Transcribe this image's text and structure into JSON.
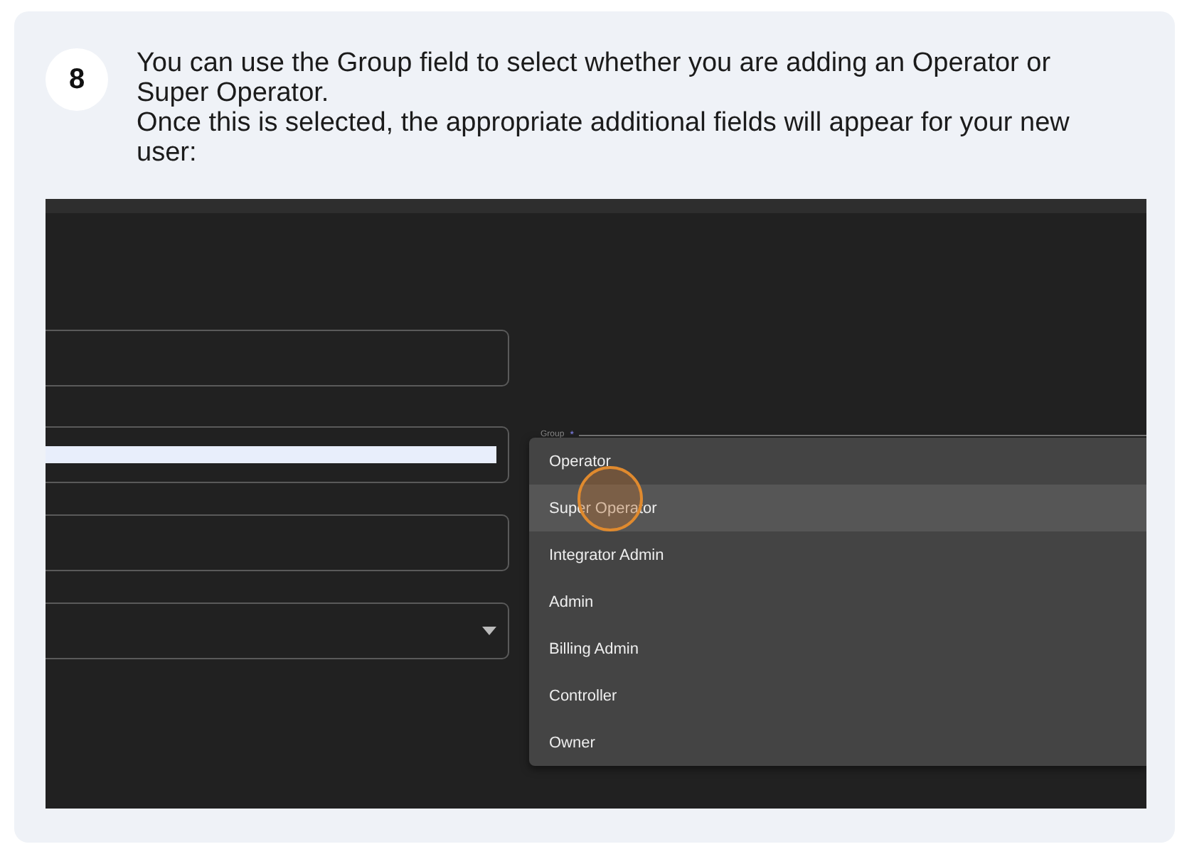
{
  "step": {
    "number": "8",
    "paragraphs": [
      "You can use the Group field to select whether you are adding an Operator or Super Operator.",
      "Once this is selected, the appropriate additional fields will appear for your new user:"
    ]
  },
  "screenshot": {
    "fields": [
      {
        "kind": "text"
      },
      {
        "kind": "autofill"
      },
      {
        "kind": "text"
      },
      {
        "kind": "select"
      }
    ],
    "group_field": {
      "label": "Group",
      "required_mark": "*"
    },
    "menu_items": [
      {
        "label": "Operator",
        "highlighted": false
      },
      {
        "label": "Super Operator",
        "highlighted": true
      },
      {
        "label": "Integrator Admin",
        "highlighted": false
      },
      {
        "label": "Admin",
        "highlighted": false
      },
      {
        "label": "Billing Admin",
        "highlighted": false
      },
      {
        "label": "Controller",
        "highlighted": false
      },
      {
        "label": "Owner",
        "highlighted": false
      }
    ]
  }
}
